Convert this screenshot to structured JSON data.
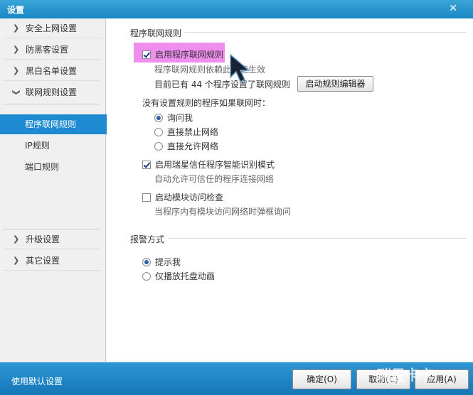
{
  "window": {
    "title": "设置",
    "close_glyph": "✕"
  },
  "sidebar": {
    "top_items": [
      {
        "label": "安全上网设置"
      },
      {
        "label": "防黑客设置"
      },
      {
        "label": "黑白名单设置"
      },
      {
        "label": "联网规则设置"
      }
    ],
    "sub_items": [
      {
        "label": "程序联网规则",
        "active": true
      },
      {
        "label": "IP规则",
        "active": false
      },
      {
        "label": "端口规则",
        "active": false
      }
    ],
    "bottom_items": [
      {
        "label": "升级设置"
      },
      {
        "label": "其它设置"
      }
    ]
  },
  "main": {
    "section1": {
      "title": "程序联网规则",
      "enable_rules": {
        "label": "启用程序联网规则",
        "checked": true
      },
      "rules_desc": "程序联网规则依赖此功能生效",
      "rules_count": "目前已有 44 个程序设置了联网规则",
      "editor_button": "启动规则编辑器",
      "no_rule_heading": "没有设置规则的程序如果联网时：",
      "options": [
        {
          "label": "询问我",
          "selected": true
        },
        {
          "label": "直接禁止网络",
          "selected": false
        },
        {
          "label": "直接允许网络",
          "selected": false
        }
      ],
      "smart_mode": {
        "label": "启用瑞星信任程序智能识别模式",
        "checked": true
      },
      "smart_desc": "自动允许可信任的程序连接网络",
      "module_check": {
        "label": "启动模块访问检查",
        "checked": false
      },
      "module_desc": "当程序内有模块访问网络时弹框询问"
    },
    "section2": {
      "title": "报警方式",
      "options": [
        {
          "label": "提示我",
          "selected": true
        },
        {
          "label": "仅播放托盘动画",
          "selected": false
        }
      ]
    }
  },
  "footer": {
    "reset_label": "使用默认设置",
    "ok_label": "确定(O)",
    "cancel_label": "取消(C)",
    "apply_label": "应用(A)",
    "watermark": "瑞星卡卡",
    "watermark_url": "ikaka"
  },
  "colors": {
    "accent": "#1e8ad2",
    "highlight": "#f08ef0"
  }
}
